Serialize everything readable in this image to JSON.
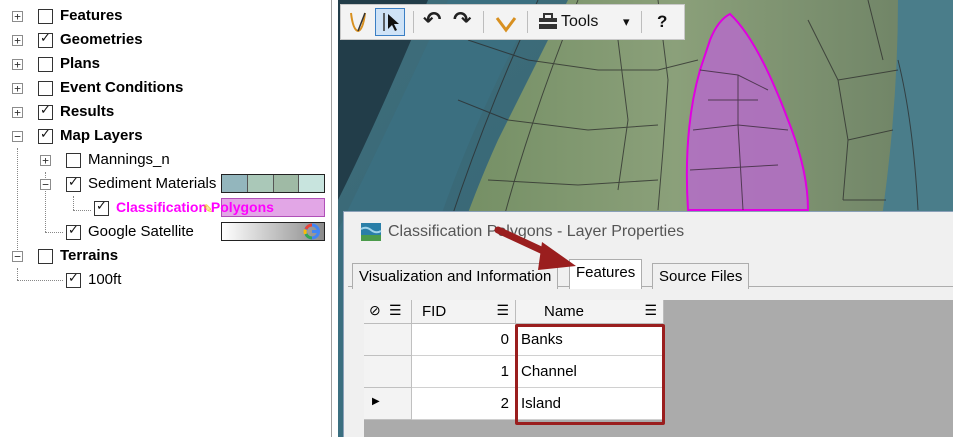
{
  "tree": {
    "items": [
      {
        "label": "Features",
        "checked": false
      },
      {
        "label": "Geometries",
        "checked": true
      },
      {
        "label": "Plans",
        "checked": false
      },
      {
        "label": "Event Conditions",
        "checked": false
      },
      {
        "label": "Results",
        "checked": true
      },
      {
        "label": "Map Layers",
        "checked": true
      },
      {
        "label": "Mannings_n",
        "checked": false
      },
      {
        "label": "Sediment Materials",
        "checked": true
      },
      {
        "label": "Classification Polygons",
        "checked": true
      },
      {
        "label": "Google Satellite",
        "checked": true
      },
      {
        "label": "Terrains",
        "checked": false
      },
      {
        "label": "100ft",
        "checked": true
      }
    ],
    "expander_plus": "+",
    "expander_minus": "−"
  },
  "toolbar": {
    "tools_label": "Tools",
    "help_label": "?",
    "dropdown_glyph": "▾",
    "undo_glyph": "↶",
    "redo_glyph": "↷"
  },
  "dialog": {
    "title": "Classification Polygons - Layer Properties",
    "tabs": [
      "Visualization and Information",
      "Features",
      "Source Files"
    ],
    "active_tab": "Features",
    "grid": {
      "columns": [
        "FID",
        "Name"
      ],
      "rows": [
        {
          "fid": "0",
          "name": "Banks"
        },
        {
          "fid": "1",
          "name": "Channel"
        },
        {
          "fid": "2",
          "name": "Island"
        }
      ],
      "current_row_marker": "▶"
    }
  },
  "colors": {
    "highlight_text": "#ff00ff",
    "polygon_fill": "#c77dd6",
    "annotation_red": "#9a1e1e",
    "sediment_swatches": [
      "#93b6bd",
      "#aac8b8",
      "#9fbaa5",
      "#c8e4de"
    ]
  }
}
